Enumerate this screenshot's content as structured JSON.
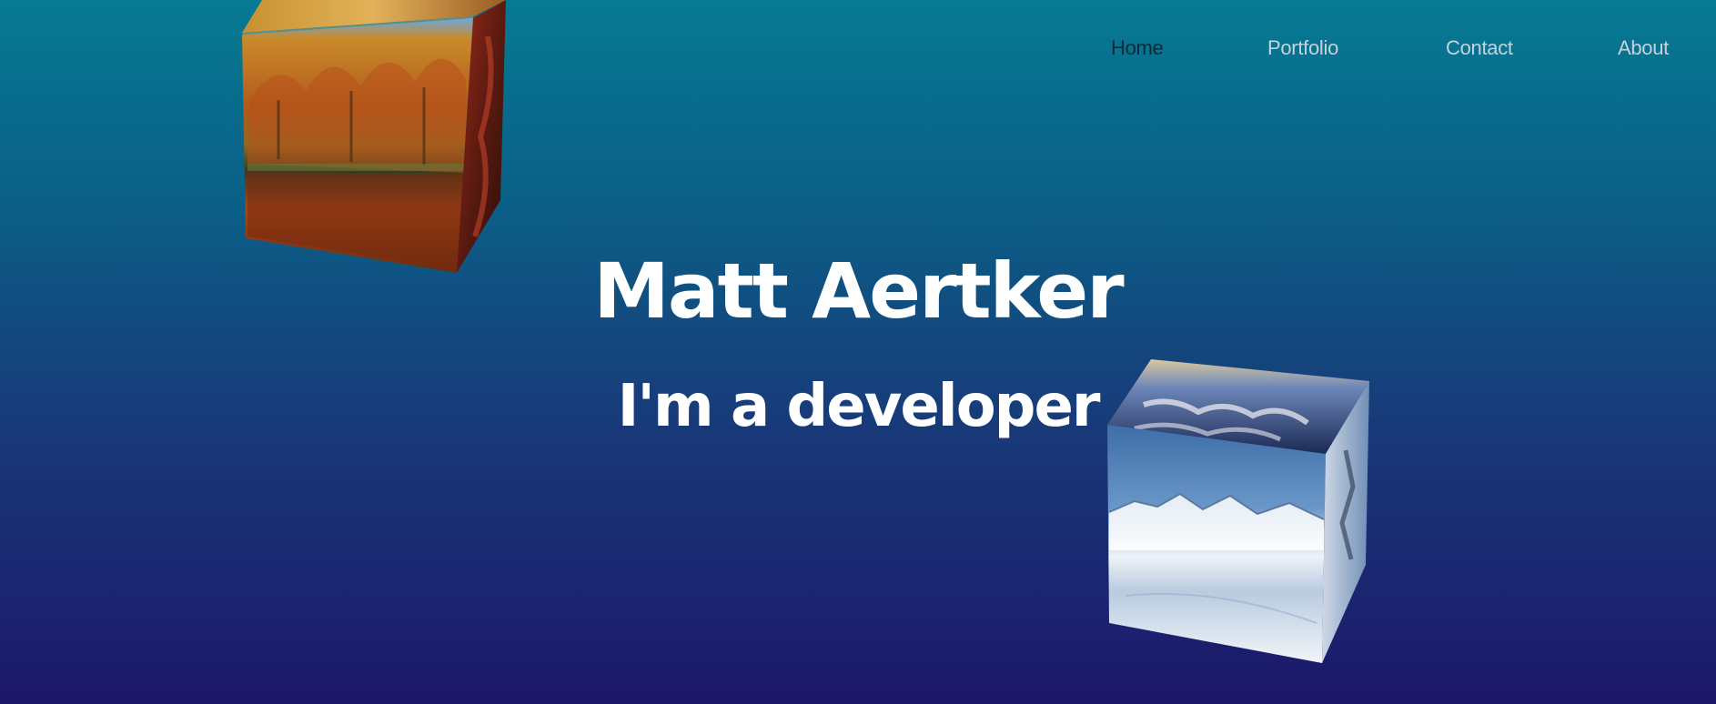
{
  "nav": {
    "items": [
      {
        "label": "Home",
        "active": true
      },
      {
        "label": "Portfolio",
        "active": false
      },
      {
        "label": "Contact",
        "active": false
      },
      {
        "label": "About",
        "active": false
      }
    ]
  },
  "hero": {
    "title": "Matt Aertker",
    "subtitle": "I'm a developer"
  },
  "colors": {
    "background_top": "#067a93",
    "background_bottom": "#1d176a",
    "nav_text": "#c5d2dc",
    "nav_active_text": "#0d2a3a",
    "hero_text": "#ffffff"
  }
}
